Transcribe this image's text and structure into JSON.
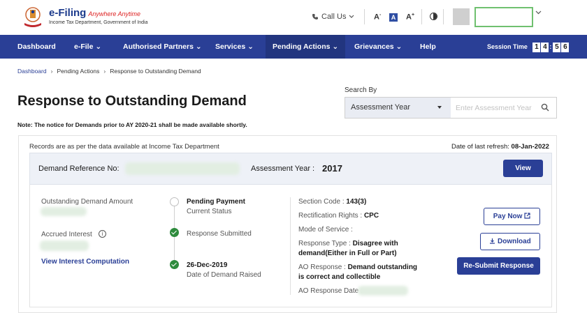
{
  "header": {
    "logo_title": "e-Filing",
    "logo_tagline": "Anywhere Anytime",
    "logo_subtitle": "Income Tax Department, Government of India",
    "call_us": "Call Us",
    "font_decrease": "A",
    "font_default": "A",
    "font_increase": "A"
  },
  "nav": {
    "items": [
      "Dashboard",
      "e-File",
      "Authorised Partners",
      "Services",
      "Pending Actions",
      "Grievances",
      "Help"
    ],
    "session_label": "Session Time",
    "session_digits": [
      "1",
      "4",
      "5",
      "6"
    ]
  },
  "breadcrumb": [
    "Dashboard",
    "Pending Actions",
    "Response to Outstanding Demand"
  ],
  "page": {
    "title": "Response to Outstanding Demand",
    "note": "Note: The notice for Demands prior to AY 2020-21 shall be made available shortly."
  },
  "search": {
    "label": "Search By",
    "selected": "Assessment Year",
    "placeholder": "Enter Assessment Year"
  },
  "card": {
    "records_note": "Records are as per the data available at Income Tax Department",
    "refresh_label": "Date of last refresh:",
    "refresh_date": "08-Jan-2022",
    "demand_ref_label": "Demand Reference No:",
    "ay_label": "Assessment Year :",
    "ay_value": "2017",
    "view_button": "View",
    "outstanding_label": "Outstanding Demand Amount",
    "accrued_label": "Accrued Interest",
    "interest_link": "View Interest Computation",
    "timeline": [
      {
        "title": "Pending Payment",
        "sub": "Current Status",
        "done": false
      },
      {
        "title": "",
        "sub": "Response Submitted",
        "done": true
      },
      {
        "title": "26-Dec-2019",
        "sub": "Date of Demand Raised",
        "done": true
      }
    ],
    "section_code_label": "Section Code :",
    "section_code": "143(3)",
    "rectification_label": "Rectification Rights :",
    "rectification": "CPC",
    "mode_label": "Mode of Service :",
    "response_type_label": "Response Type :",
    "response_type_line1": "Disagree with",
    "response_type_line2": "demand(Either in Full or Part)",
    "ao_response_label": "AO Response :",
    "ao_response_line1": "Demand outstanding",
    "ao_response_line2": "is correct and collectible",
    "ao_response_date_label": "AO Response Date :",
    "pay_now": "Pay Now",
    "download": "Download",
    "resubmit": "Re-Submit Response"
  },
  "colors": {
    "brand": "#2a3f96",
    "success": "#2e8b3d"
  }
}
